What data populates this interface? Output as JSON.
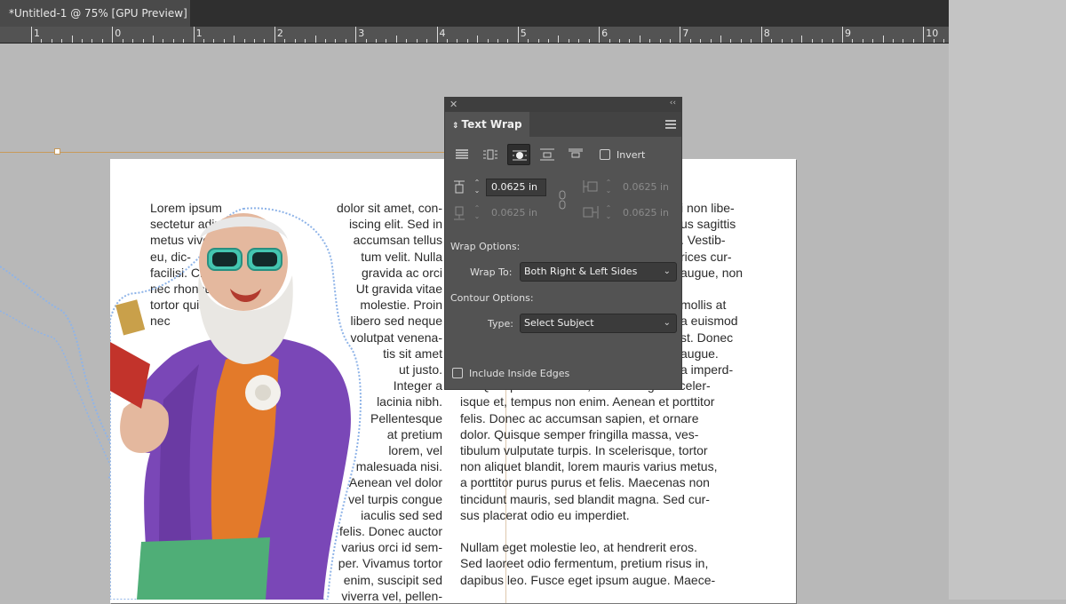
{
  "document_tab": {
    "title": "*Untitled-1 @ 75% [GPU Preview]"
  },
  "ruler": {
    "labels": [
      "1",
      "0",
      "1",
      "2",
      "3",
      "4",
      "5",
      "6",
      "7",
      "8",
      "9",
      "10"
    ]
  },
  "page": {
    "column1": [
      "Lorem ipsum",
      "sectetur adip-",
      "metus viverra,",
      "eu, dic-",
      "facilisi. Cras",
      "nec rhoncus.",
      "tortor quis",
      "nec"
    ],
    "column2": [
      "dolor sit amet, con-",
      "iscing elit. Sed in",
      "accumsan tellus",
      "tum velit. Nulla",
      "gravida ac orci",
      "Ut gravida vitae",
      "molestie. Proin",
      "libero sed neque",
      "volutpat venena-",
      "tis sit amet",
      "ut justo.",
      "Integer a",
      "lacinia nibh.",
      "Pellentesque",
      "at pretium",
      "lorem, vel",
      "malesuada nisi.",
      "Aenean vel dolor",
      "vel turpis congue",
      "iaculis sed sed",
      "felis. Donec auctor",
      "varius orci id sem-",
      "per. Vivamus tortor",
      "enim, suscipit sed",
      "viverra vel, pellen-"
    ],
    "column3_top": [
      "i non libe-",
      "us sagittis",
      ". Vestib-",
      "rices cur-",
      "augue, non",
      "",
      "mollis at",
      "a euismod",
      "st. Donec",
      "augue.",
      "a imperd-"
    ],
    "column3_bottom": [
      "iet. Quisque mauris dui, luctus fringilla sceler-",
      "isque et, tempus non enim. Aenean et porttitor",
      "felis. Donec ac accumsan sapien, et ornare",
      "dolor. Quisque semper fringilla massa, ves-",
      "tibulum vulputate turpis. In scelerisque, tortor",
      "non aliquet blandit, lorem mauris varius metus,",
      "a porttitor purus purus et felis. Maecenas non",
      "tincidunt mauris, sed blandit magna. Sed cur-",
      "sus placerat odio eu imperdiet.",
      "",
      "Nullam eget molestie leo, at hendrerit eros.",
      "Sed laoreet odio fermentum, pretium risus in,",
      "dapibus leo. Fusce eget ipsum augue. Maece-"
    ]
  },
  "text_wrap_panel": {
    "tab_label": "Text Wrap",
    "close_glyph": "✕",
    "collapse_glyph": "‹‹",
    "invert_label": "Invert",
    "invert_checked": false,
    "wrap_mode_selected": "wrap-around-object-shape",
    "top_offset": "0.0625 in",
    "bottom_offset": "0.0625 in",
    "left_offset": "0.0625 in",
    "right_offset": "0.0625 in",
    "wrap_options_heading": "Wrap Options:",
    "wrap_to_label": "Wrap To:",
    "wrap_to_value": "Both Right & Left Sides",
    "contour_options_heading": "Contour Options:",
    "type_label": "Type:",
    "type_value": "Select Subject",
    "include_inside_edges_label": "Include Inside Edges",
    "include_inside_edges_checked": false
  },
  "colors": {
    "accent_guide": "#c89a5a",
    "panel_bg": "#535353",
    "wrap_outline": "#8fb4e8"
  }
}
